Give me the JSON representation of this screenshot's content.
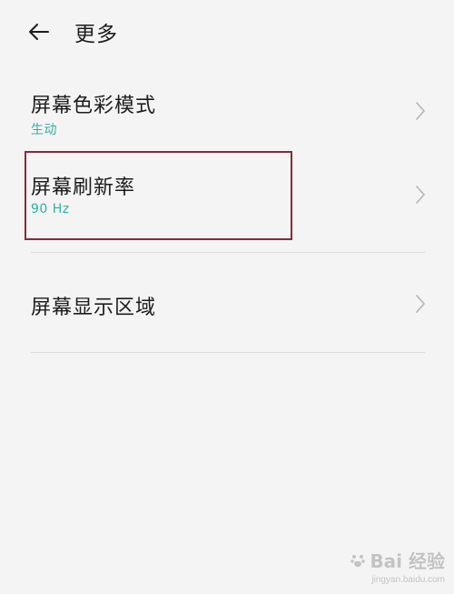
{
  "header": {
    "back_icon": "arrow-left-icon",
    "title": "更多"
  },
  "settings": {
    "color_mode": {
      "label": "屏幕色彩模式",
      "value": "生动"
    },
    "refresh_rate": {
      "label": "屏幕刷新率",
      "value": "90 Hz"
    },
    "display_area": {
      "label": "屏幕显示区域"
    }
  },
  "colors": {
    "accent": "#2fb0a0",
    "highlight_border": "#8a2a35",
    "background": "#f4f4f4"
  },
  "watermark": {
    "brand": "Bai 经验",
    "url": "jingyan.baidu.com"
  }
}
